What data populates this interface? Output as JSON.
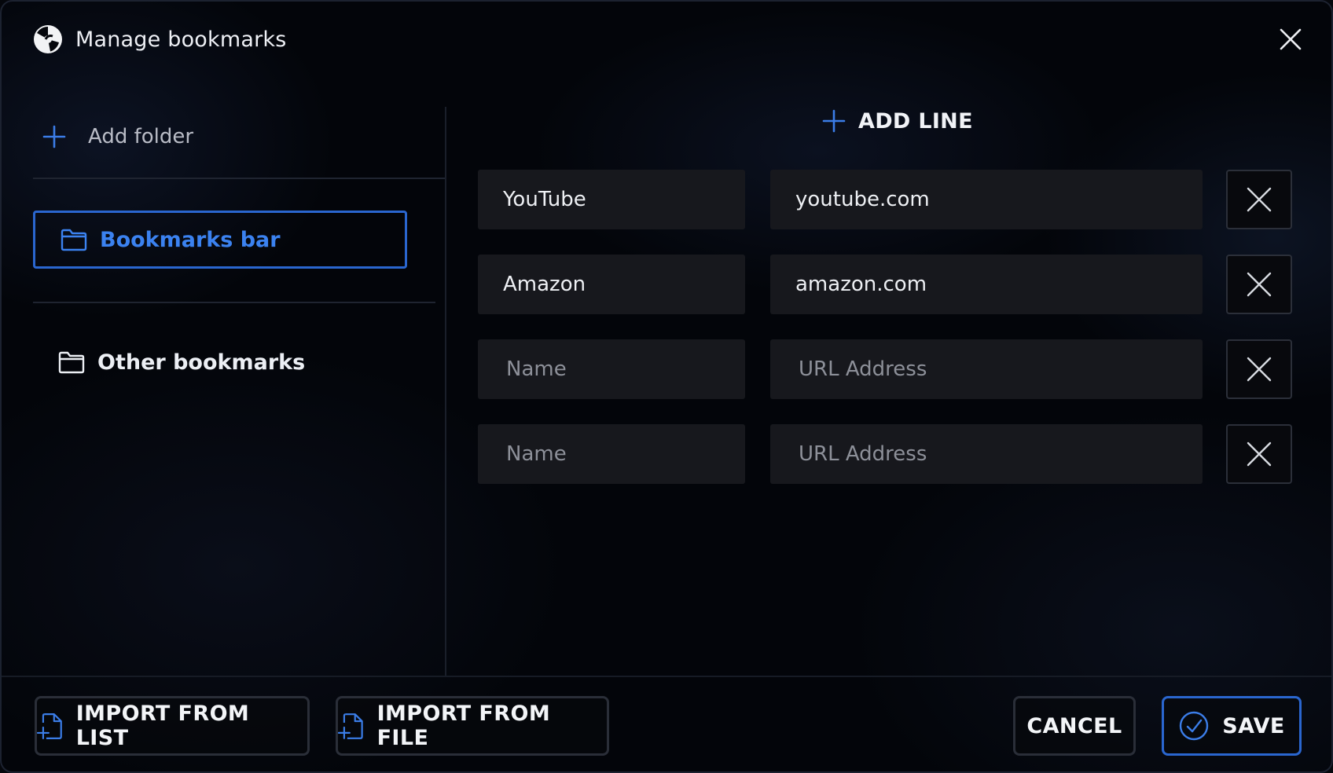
{
  "dialog": {
    "title": "Manage bookmarks"
  },
  "sidebar": {
    "add_folder_label": "Add folder",
    "folders": [
      {
        "label": "Bookmarks bar",
        "active": true
      },
      {
        "label": "Other bookmarks",
        "active": false
      }
    ]
  },
  "main": {
    "add_line_label": "ADD LINE",
    "rows": [
      {
        "name": "YouTube",
        "url": "youtube.com"
      },
      {
        "name": "Amazon",
        "url": "amazon.com"
      },
      {
        "name": "",
        "url": ""
      },
      {
        "name": "",
        "url": ""
      }
    ],
    "name_placeholder": "Name",
    "url_placeholder": "URL Address"
  },
  "footer": {
    "import_list_label": "IMPORT FROM LIST",
    "import_file_label": "IMPORT FROM FILE",
    "cancel_label": "CANCEL",
    "save_label": "SAVE"
  },
  "colors": {
    "accent": "#2a66cf",
    "active_text": "#3b82f0",
    "background": "#03050a",
    "field_bg": "#17181d"
  },
  "icons": {
    "logo": "app-logo-icon",
    "close": "close-icon",
    "plus": "plus-icon",
    "folder": "folder-icon",
    "delete": "x-icon",
    "file_import": "file-plus-icon",
    "check": "check-circle-icon"
  }
}
